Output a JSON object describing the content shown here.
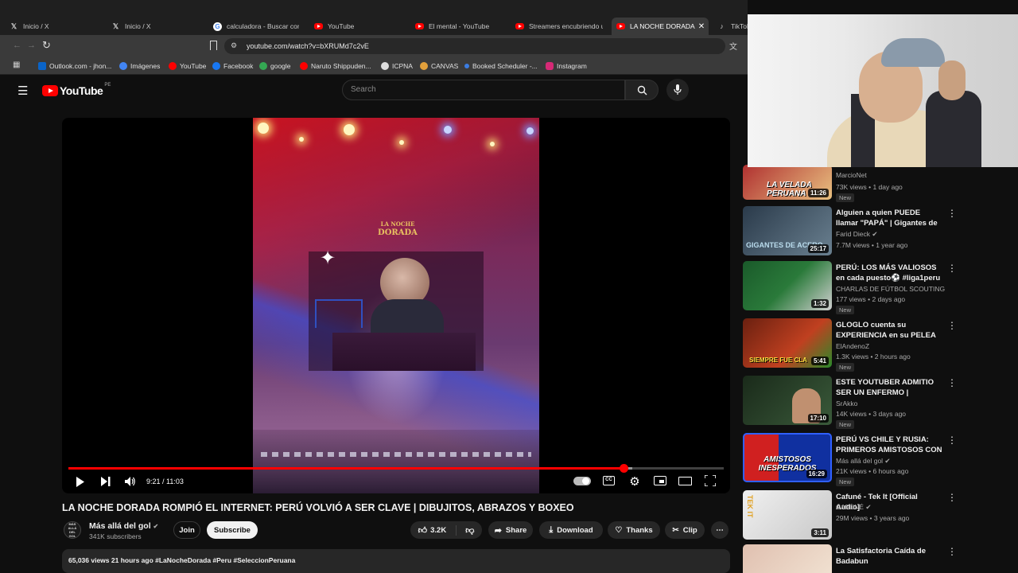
{
  "browser": {
    "tabs": [
      {
        "label": "Inicio / X",
        "icon": "x-icon"
      },
      {
        "label": "Inicio / X",
        "icon": "x-icon"
      },
      {
        "label": "calculadora - Buscar con G",
        "icon": "google-icon"
      },
      {
        "label": "YouTube",
        "icon": "youtube-icon"
      },
      {
        "label": "El mental - YouTube",
        "icon": "youtube-icon"
      },
      {
        "label": "Streamers encubriendo ur",
        "icon": "youtube-icon"
      },
      {
        "label": "LA NOCHE DORADA",
        "icon": "youtube-icon",
        "active": true
      },
      {
        "label": "TikTok",
        "icon": "tiktok-icon"
      }
    ],
    "url": "youtube.com/watch?v=bXRUMd7c2vE",
    "bookmarks": [
      {
        "label": "Outlook.com - jhon...",
        "color": "#0a64c8"
      },
      {
        "label": "Imágenes",
        "color": "#4285f4"
      },
      {
        "label": "YouTube",
        "color": "#ff0000"
      },
      {
        "label": "Facebook",
        "color": "#1877f2"
      },
      {
        "label": "google",
        "color": "#34a853"
      },
      {
        "label": "Naruto Shippuden...",
        "color": "#ff0000"
      },
      {
        "label": "ICPNA",
        "color": "#dddddd"
      },
      {
        "label": "CANVAS",
        "color": "#e2a03b"
      },
      {
        "label": "Booked Scheduler -...",
        "color": "#3b7de2"
      },
      {
        "label": "Instagram",
        "color": "#d62976"
      }
    ]
  },
  "youtube": {
    "logo_text": "YouTube",
    "country": "PE",
    "search_placeholder": "Search",
    "accent": "#ff0000"
  },
  "player": {
    "time": "9:21 / 11:03",
    "progress": 0.847,
    "buffered": 0.86,
    "sign_text_1": "LA NOCHE",
    "sign_text_2": "DORADA"
  },
  "video": {
    "title": "LA NOCHE DORADA ROMPIÓ EL INTERNET: PERÚ VOLVIÓ A SER CLAVE | DIBUJITOS, ABRAZOS Y BOXEO",
    "channel": "Más allá del gol",
    "avatar_text": "MÁS ALLÁ DEL GOL",
    "subscribers": "341K subscribers",
    "join_label": "Join",
    "subscribe_label": "Subscribe",
    "likes": "3.2K",
    "share_label": "Share",
    "download_label": "Download",
    "thanks_label": "Thanks",
    "clip_label": "Clip",
    "description_preview": "65,036 views  21 hours ago  #LaNocheDorada #Peru #SeleccionPeruana"
  },
  "recommendations": [
    {
      "title": "",
      "thumb_text": "LA VELADA PERUANA",
      "channel": "MarcioNet",
      "meta": "73K views • 1 day ago",
      "duration": "11:26",
      "new": "New",
      "colors": [
        "#b03030",
        "#e8c080"
      ]
    },
    {
      "title": "Alguien a quien PUEDE llamar \"PAPÁ\" | Gigantes de Acero | ...",
      "thumb_text": "GIGANTES DE ACERO",
      "channel": "Farid Dieck",
      "meta": "7.7M views • 1 year ago",
      "duration": "25:17",
      "new": "",
      "colors": [
        "#2a3a4a",
        "#6a8090"
      ]
    },
    {
      "title": "PERÚ: LOS MÁS VALIOSOS en cada puesto⚽ #liga1peru ...",
      "thumb_text": "",
      "channel": "CHARLAS DE FÚTBOL SCOUTING",
      "meta": "177 views • 2 days ago",
      "duration": "1:32",
      "new": "New",
      "colors": [
        "#1a5a2a",
        "#d0d0d0"
      ]
    },
    {
      "title": "GLOGLO cuenta su EXPERIENCIA en su PELEA ...",
      "thumb_text": "SIEMPRE FUE CLA",
      "channel": "ElAndenoZ",
      "meta": "1.3K views • 2 hours ago",
      "duration": "5:41",
      "new": "New",
      "colors": [
        "#6a2010",
        "#c04020"
      ]
    },
    {
      "title": "ESTE YOUTUBER ADMITIO SER UN ENFERMO | TheDaarick28",
      "thumb_text": "",
      "channel": "SrAkko",
      "meta": "14K views • 3 days ago",
      "duration": "17:10",
      "new": "New",
      "colors": [
        "#1a2a1a",
        "#3a5a3a"
      ]
    },
    {
      "title": "PERÚ VS CHILE Y RUSIA: PRIMEROS AMISTOSOS CON ...",
      "thumb_text": "AMISTOSOS INESPERADOS",
      "channel": "Más allá del gol",
      "meta": "21K views • 6 hours ago",
      "duration": "16:29",
      "new": "New",
      "colors": [
        "#1030a0",
        "#d02020"
      ]
    },
    {
      "title": "Cafuné - Tek It [Official Audio]",
      "thumb_text": "TEK IT",
      "channel": "CAFUNÉ",
      "meta": "29M views • 3 years ago",
      "duration": "3:11",
      "new": "",
      "colors": [
        "#f0f0f0",
        "#c8c8c8"
      ]
    },
    {
      "title": "La Satisfactoria Caída de Badabun",
      "thumb_text": "",
      "channel": "",
      "meta": "",
      "duration": "",
      "new": "",
      "colors": [
        "#e0c0b0",
        "#f0e0d0"
      ]
    }
  ]
}
